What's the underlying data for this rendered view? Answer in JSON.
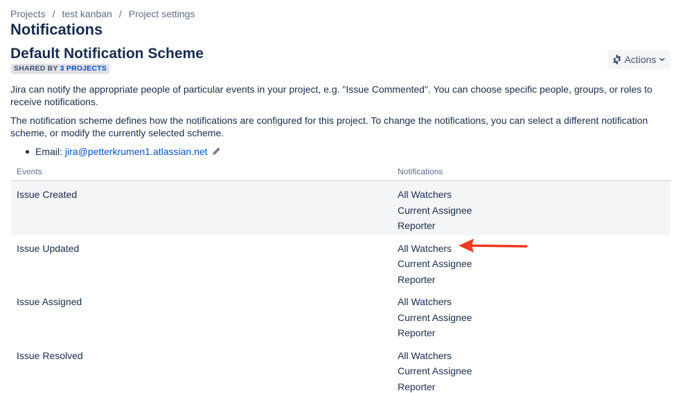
{
  "breadcrumb": {
    "items": [
      "Projects",
      "test kanban",
      "Project settings"
    ],
    "separator": "/"
  },
  "page_title": "Notifications",
  "scheme": {
    "title": "Default Notification Scheme",
    "shared_prefix": "SHARED BY",
    "shared_link": "3 PROJECTS"
  },
  "actions": {
    "label": "Actions",
    "icon": "gear-icon"
  },
  "description": {
    "p1": "Jira can notify the appropriate people of particular events in your project, e.g. \"Issue Commented\". You can choose specific people, groups, or roles to receive notifications.",
    "p2": "The notification scheme defines how the notifications are configured for this project. To change the notifications, you can select a different notification scheme, or modify the currently selected scheme."
  },
  "email": {
    "label": "Email:",
    "address": "jira@petterkrumen1.atlassian.net",
    "edit_icon": "pencil-icon"
  },
  "table": {
    "headers": {
      "events": "Events",
      "notifications": "Notifications"
    },
    "rows": [
      {
        "event": "Issue Created",
        "notifications": [
          "All Watchers",
          "Current Assignee",
          "Reporter"
        ]
      },
      {
        "event": "Issue Updated",
        "notifications": [
          "All Watchers",
          "Current Assignee",
          "Reporter"
        ]
      },
      {
        "event": "Issue Assigned",
        "notifications": [
          "All Watchers",
          "Current Assignee",
          "Reporter"
        ]
      },
      {
        "event": "Issue Resolved",
        "notifications": [
          "All Watchers",
          "Current Assignee",
          "Reporter"
        ]
      }
    ]
  },
  "colors": {
    "text_primary": "#172b4d",
    "text_secondary": "#5e6c84",
    "link": "#0052cc",
    "row_highlight": "#f4f5f7",
    "annotation_arrow": "#ee3b1f"
  }
}
